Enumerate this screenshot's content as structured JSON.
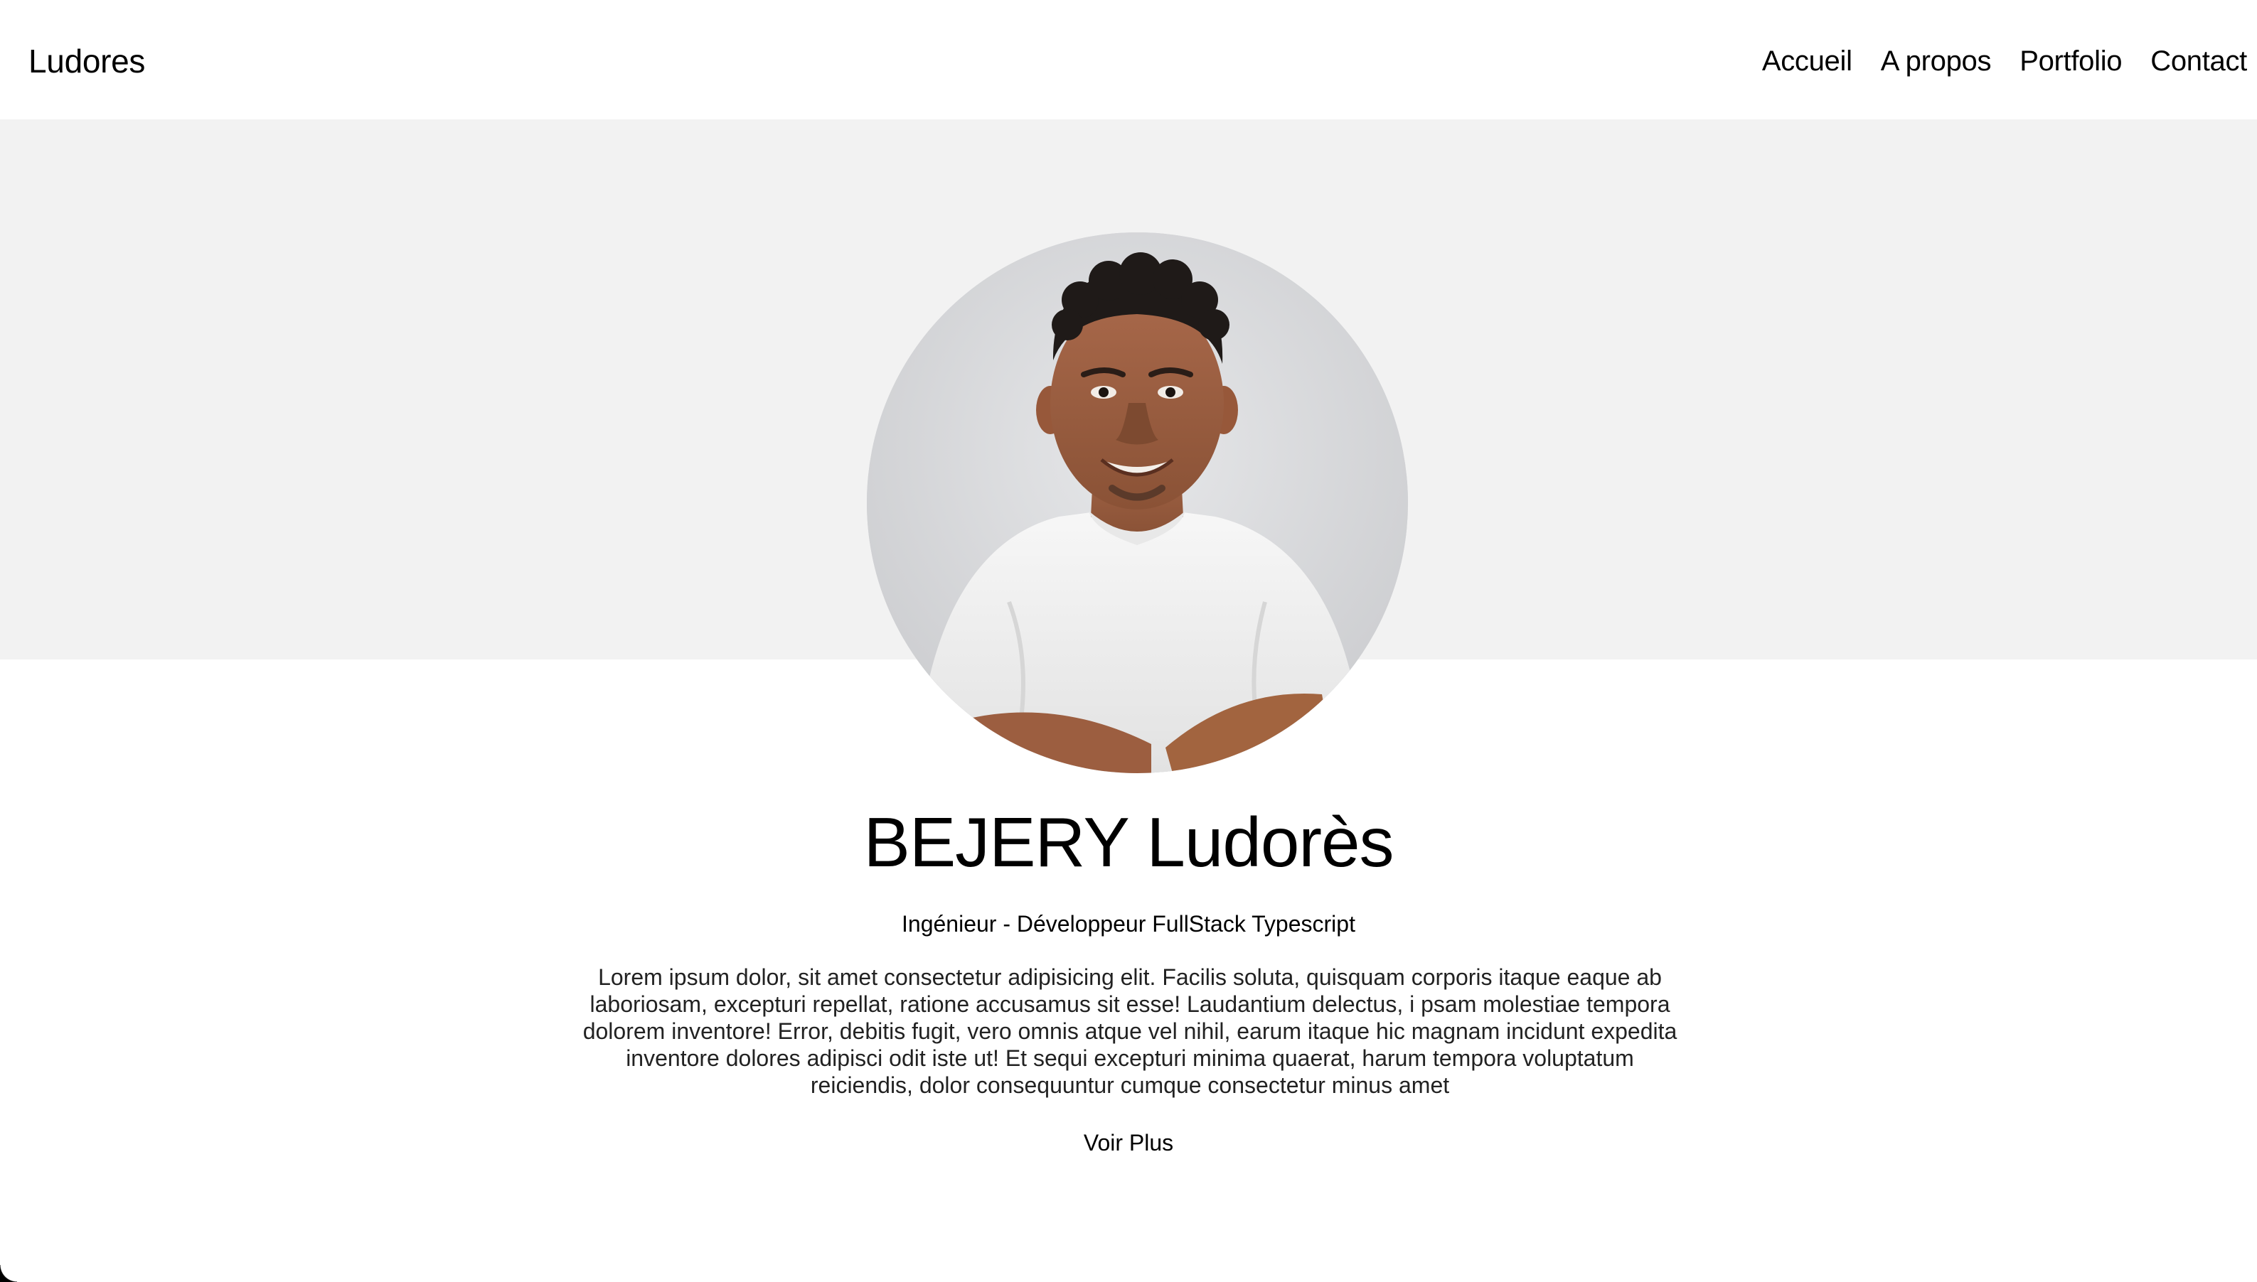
{
  "header": {
    "brand": "Ludores",
    "nav": [
      {
        "label": "Accueil"
      },
      {
        "label": "A propos"
      },
      {
        "label": "Portfolio"
      },
      {
        "label": "Contact"
      }
    ]
  },
  "hero": {
    "name": "BEJERY Ludorès",
    "role": "Ingénieur - Développeur FullStack Typescript",
    "bio": "Lorem ipsum dolor, sit amet consectetur adipisicing elit. Facilis soluta, quisquam corporis itaque eaque ab laboriosam, excepturi repellat, ratione accusamus sit esse! Laudantium delectus, i psam molestiae tempora dolorem inventore! Error, debitis fugit, vero omnis atque vel nihil, earum itaque hic magnam incidunt expedita inventore dolores adipisci odit iste ut! Et sequi excepturi minima quaerat, harum tempora voluptatum reiciendis, dolor consequuntur cumque consectetur minus amet",
    "cta": "Voir Plus"
  },
  "colors": {
    "band": "#f2f2f2",
    "background": "#ffffff",
    "text": "#000000"
  }
}
